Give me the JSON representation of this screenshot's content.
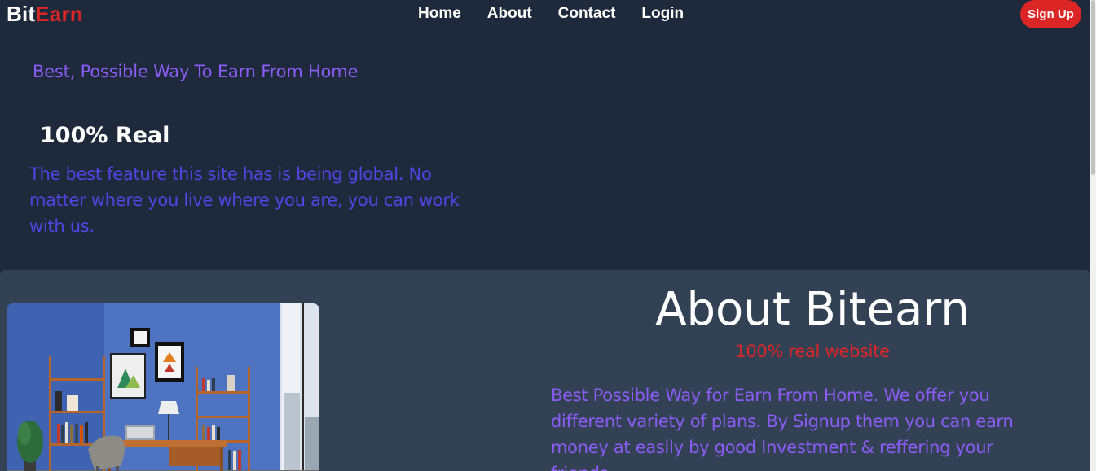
{
  "brand": {
    "part1": "Bit",
    "part2": "Earn"
  },
  "nav": {
    "items": [
      {
        "label": "Home"
      },
      {
        "label": "About"
      },
      {
        "label": "Contact"
      },
      {
        "label": "Login"
      }
    ],
    "signup_label": "Sign Up"
  },
  "hero": {
    "tagline": "Best, Possible Way To Earn From Home",
    "heading": "100% Real",
    "text": "The best feature this site has is being global. No matter where you live where you are, you can work with us."
  },
  "about": {
    "title": "About Bitearn",
    "subtitle": "100% real website",
    "text": "Best Possible Way for Earn From Home. We offer you different variety of plans. By Signup them you can earn money at easily by good Investment & reffering your friends."
  },
  "colors": {
    "background": "#1e293b",
    "section": "#334155",
    "accent_red": "#dc2626",
    "purple": "#8b5cf6",
    "indigo": "#4f46e5"
  }
}
